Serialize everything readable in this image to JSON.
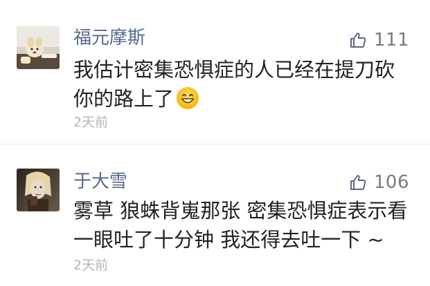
{
  "comments": [
    {
      "author": "福元摩斯",
      "likes": "111",
      "text": "我估计密集恐惧症的人已经在提刀砍你的路上了",
      "emoji": "grinning-face-emoji",
      "time": "2天前"
    },
    {
      "author": "于大雪",
      "likes": "106",
      "text": "雾草 狼蛛背嵬那张 密集恐惧症表示看一眼吐了十分钟 我还得去吐一下 ~",
      "time": "2天前"
    }
  ],
  "colors": {
    "author": "#55698c",
    "text": "#222222",
    "meta": "#b4b4b4",
    "like": "#7b7b7b"
  }
}
